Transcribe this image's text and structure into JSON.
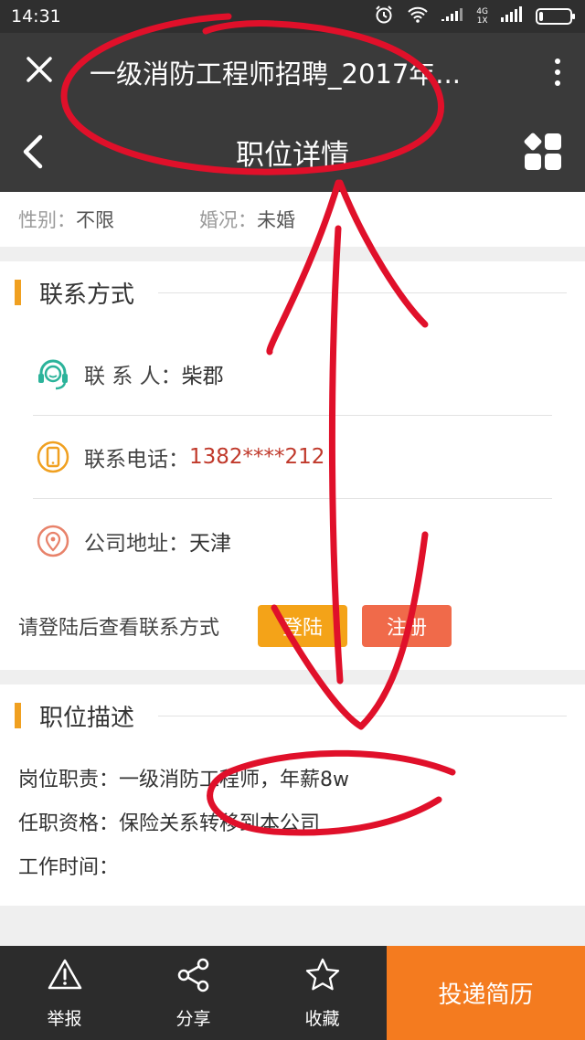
{
  "status_bar": {
    "time": "14:31",
    "network_top": "4G",
    "network_bottom": "1X"
  },
  "window": {
    "title": "一级消防工程师招聘_2017年..."
  },
  "nav": {
    "title": "职位详情"
  },
  "basic_info": {
    "gender_label": "性别：",
    "gender_value": "不限",
    "marital_label": "婚况：",
    "marital_value": "未婚"
  },
  "contact": {
    "heading": "联系方式",
    "person_label": "联 系 人：",
    "person_value": "柴郡",
    "phone_label": "联系电话：",
    "phone_value": "1382****212",
    "address_label": "公司地址：",
    "address_value": "天津",
    "login_prompt": "请登陆后查看联系方式",
    "login_button": "登陆",
    "register_button": "注册"
  },
  "description": {
    "heading": "职位描述",
    "duties": "岗位职责：一级消防工程师，年薪8w",
    "requirements": "任职资格：保险关系转移到本公司",
    "work_time": "工作时间："
  },
  "bottom_bar": {
    "report": "举报",
    "share": "分享",
    "favorite": "收藏",
    "apply": "投递简历"
  },
  "colors": {
    "accent": "#f47b1f",
    "phone": "#c0392b",
    "annotation": "#e0102a"
  },
  "icons": [
    "close-icon",
    "more-icon",
    "back-icon",
    "grid-icon",
    "headset-icon",
    "phone-icon",
    "location-icon",
    "warning-icon",
    "share-icon",
    "star-icon"
  ]
}
